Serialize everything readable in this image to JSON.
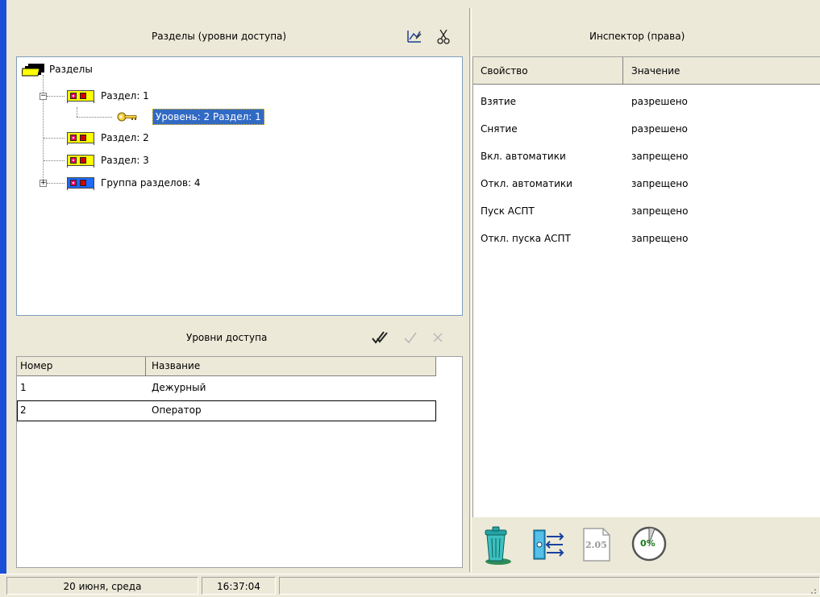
{
  "sections_panel": {
    "title": "Разделы (уровни доступа)",
    "tree": {
      "root_label": "Разделы",
      "items": [
        {
          "label": "Раздел: 1",
          "expanded": true
        },
        {
          "label": "Уровень: 2 Раздел: 1",
          "selected": true
        },
        {
          "label": "Раздел: 2"
        },
        {
          "label": "Раздел: 3"
        },
        {
          "label": "Группа разделов: 4",
          "expanded": false
        }
      ]
    },
    "toolbar": {
      "edit_icon": "edit-icon",
      "cut_icon": "scissors-icon"
    }
  },
  "levels_panel": {
    "title": "Уровни доступа",
    "toolbar": {
      "check_all_icon": "double-check-icon",
      "check_icon": "check-icon",
      "cancel_icon": "cross-icon"
    },
    "columns": [
      "Номер",
      "Название"
    ],
    "rows": [
      {
        "number": "1",
        "name": "Дежурный"
      },
      {
        "number": "2",
        "name": "Оператор"
      }
    ]
  },
  "inspector": {
    "title": "Инспектор (права)",
    "columns": [
      "Свойство",
      "Значение"
    ],
    "rows": [
      {
        "property": "Взятие",
        "value": "разрешено"
      },
      {
        "property": "Снятие",
        "value": "разрешено"
      },
      {
        "property": "Вкл. автоматики",
        "value": "запрещено"
      },
      {
        "property": "Откл. автоматики",
        "value": "запрещено"
      },
      {
        "property": "Пуск АСПТ",
        "value": "запрещено"
      },
      {
        "property": "Откл. пуска АСПТ",
        "value": "запрещено"
      }
    ],
    "bottom_icons": {
      "trash": "trash-icon",
      "device": "device-icon",
      "version_label": "2.05",
      "progress_label": "0%"
    }
  },
  "statusbar": {
    "date": "20 июня, среда",
    "time": "16:37:04"
  },
  "colors": {
    "accent": "#1b4fd6",
    "selection": "#316ac5",
    "window_bg": "#ece9d8",
    "node_yellow": "#ffff00",
    "node_blue": "#1e6bff"
  }
}
